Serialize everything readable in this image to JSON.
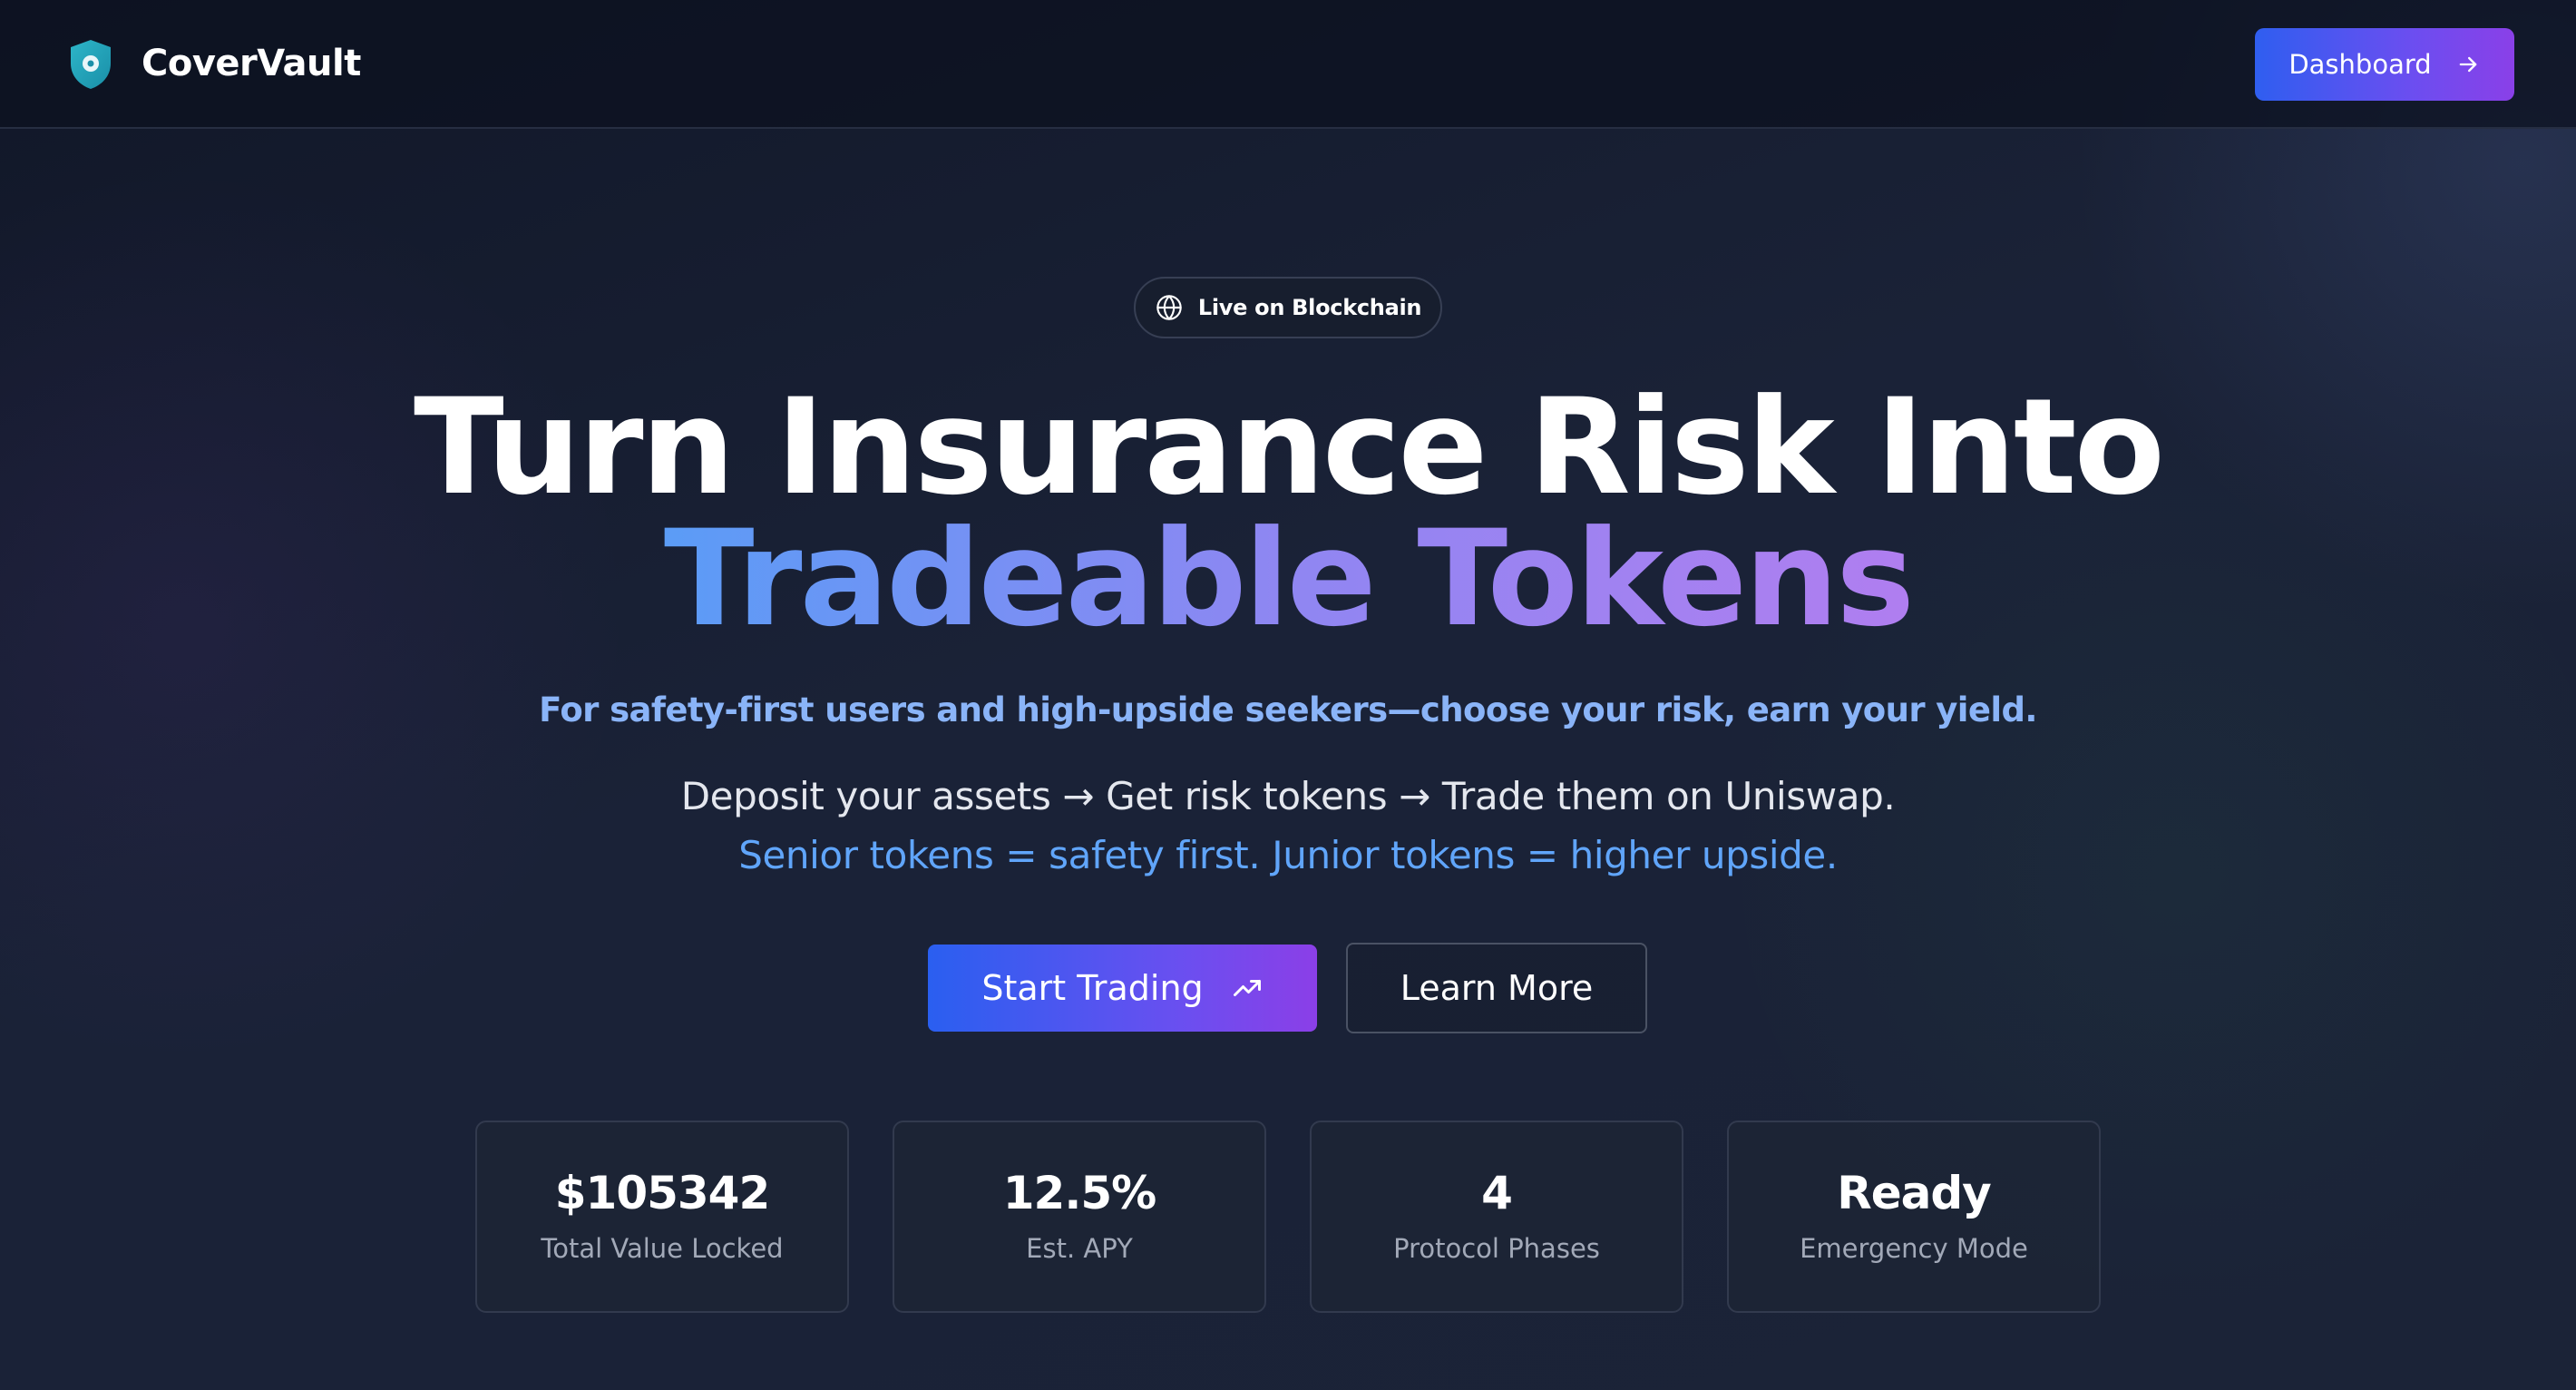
{
  "header": {
    "brand": "CoverVault",
    "dashboard_label": "Dashboard"
  },
  "hero": {
    "badge": "Live on Blockchain",
    "headline_line1": "Turn Insurance Risk Into",
    "headline_line2": "Tradeable Tokens",
    "tagline": "For safety-first users and high-upside seekers—choose your risk, earn your yield.",
    "description_line1": "Deposit your assets → Get risk tokens → Trade them on Uniswap.",
    "description_line2": "Senior tokens = safety first. Junior tokens = higher upside.",
    "primary_cta": "Start Trading",
    "secondary_cta": "Learn More"
  },
  "stats": [
    {
      "value": "$105342",
      "label": "Total Value Locked"
    },
    {
      "value": "12.5%",
      "label": "Est. APY"
    },
    {
      "value": "4",
      "label": "Protocol Phases"
    },
    {
      "value": "Ready",
      "label": "Emergency Mode"
    }
  ],
  "icons": {
    "logo": "shield-icon",
    "dashboard": "arrow-right-icon",
    "badge": "globe-icon",
    "primary_cta": "trending-up-icon"
  },
  "colors": {
    "accent_blue": "#2f5ef0",
    "accent_purple": "#8a40e8",
    "tagline": "#8ab4f8",
    "highlight_blue": "#60a5fa",
    "logo_teal": "#14b8a6"
  }
}
